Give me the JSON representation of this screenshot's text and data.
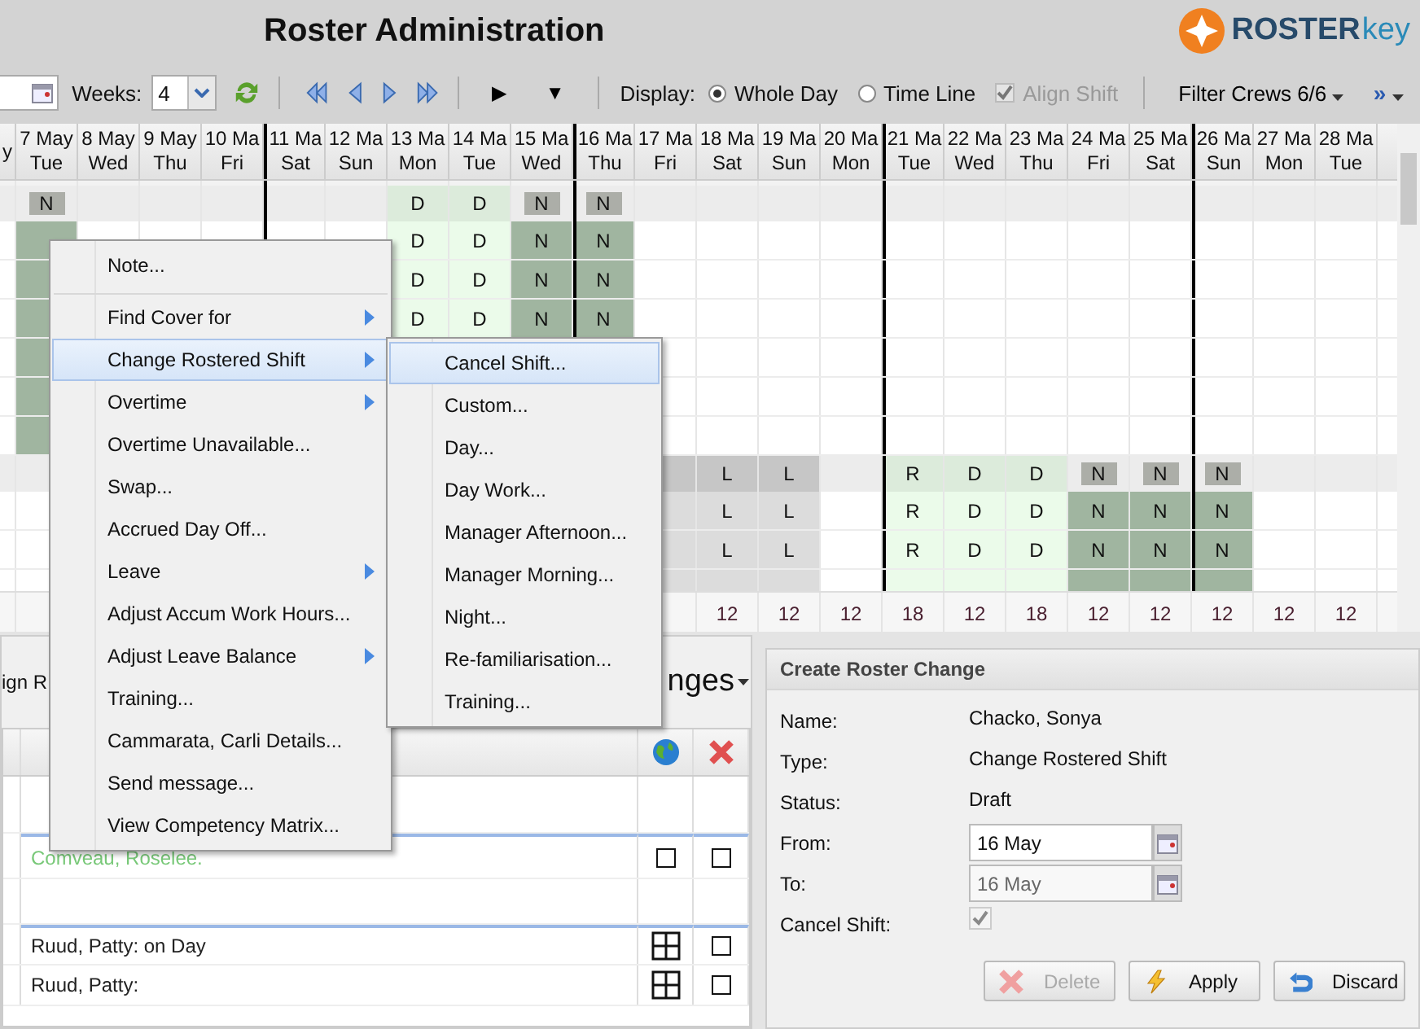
{
  "header": {
    "title": "Roster Administration",
    "logo_primary": "ROSTER",
    "logo_secondary": "key"
  },
  "toolbar": {
    "weeks_label": "Weeks:",
    "weeks_value": "4",
    "play_glyph": "▶",
    "down_glyph": "▼",
    "display_label": "Display:",
    "display_options": [
      {
        "label": "Whole Day",
        "selected": true
      },
      {
        "label": "Time Line",
        "selected": false
      }
    ],
    "align_shift": {
      "label": "Align Shift",
      "checked": true,
      "disabled": true
    },
    "filter_label": "Filter Crews 6/6",
    "more_glyph": "»"
  },
  "columns": [
    {
      "date": "y",
      "week_start": false
    },
    {
      "date": "7 May",
      "day": "Tue",
      "week_start": false
    },
    {
      "date": "8 May",
      "day": "Wed",
      "week_start": false
    },
    {
      "date": "9 May",
      "day": "Thu",
      "week_start": false
    },
    {
      "date": "10 Ma",
      "day": "Fri",
      "week_start": false
    },
    {
      "date": "11 Ma",
      "day": "Sat",
      "week_start": true
    },
    {
      "date": "12 Ma",
      "day": "Sun",
      "week_start": false
    },
    {
      "date": "13 Ma",
      "day": "Mon",
      "week_start": false
    },
    {
      "date": "14 Ma",
      "day": "Tue",
      "week_start": false
    },
    {
      "date": "15 Ma",
      "day": "Wed",
      "week_start": false
    },
    {
      "date": "16 Ma",
      "day": "Thu",
      "week_start": true
    },
    {
      "date": "17 Ma",
      "day": "Fri",
      "week_start": false
    },
    {
      "date": "18 Ma",
      "day": "Sat",
      "week_start": false,
      "total": "12"
    },
    {
      "date": "19 Ma",
      "day": "Sun",
      "week_start": false,
      "total": "12"
    },
    {
      "date": "20 Ma",
      "day": "Mon",
      "week_start": false,
      "total": "12"
    },
    {
      "date": "21 Ma",
      "day": "Tue",
      "week_start": true,
      "total": "18"
    },
    {
      "date": "22 Ma",
      "day": "Wed",
      "week_start": false,
      "total": "12"
    },
    {
      "date": "23 Ma",
      "day": "Thu",
      "week_start": false,
      "total": "18"
    },
    {
      "date": "24 Ma",
      "day": "Fri",
      "week_start": false,
      "total": "12"
    },
    {
      "date": "25 Ma",
      "day": "Sat",
      "week_start": false,
      "total": "12"
    },
    {
      "date": "26 Ma",
      "day": "Sun",
      "week_start": true,
      "total": "12"
    },
    {
      "date": "27 Ma",
      "day": "Mon",
      "week_start": false,
      "total": "12"
    },
    {
      "date": "28 Ma",
      "day": "Tue",
      "week_start": false,
      "total": "12"
    }
  ],
  "rows": [
    {
      "kind": "group",
      "cells": [
        null,
        {
          "code": "N",
          "kind": "night"
        },
        null,
        null,
        null,
        null,
        null,
        {
          "code": "D",
          "kind": "day"
        },
        {
          "code": "D",
          "kind": "day"
        },
        {
          "code": "N",
          "kind": "night"
        },
        {
          "code": "N",
          "kind": "night"
        },
        null,
        null,
        null,
        null,
        null,
        null,
        null,
        null,
        null,
        null,
        null,
        null
      ]
    },
    {
      "kind": "person",
      "cells": [
        null,
        {
          "kind": "night"
        },
        null,
        null,
        null,
        null,
        null,
        {
          "code": "D",
          "kind": "day"
        },
        {
          "code": "D",
          "kind": "day"
        },
        {
          "code": "N",
          "kind": "night"
        },
        {
          "code": "N",
          "kind": "night"
        },
        null,
        null,
        null,
        null,
        null,
        null,
        null,
        null,
        null,
        null,
        null,
        null
      ]
    },
    {
      "kind": "person",
      "cells": [
        null,
        {
          "kind": "night"
        },
        null,
        null,
        null,
        null,
        null,
        {
          "code": "D",
          "kind": "day"
        },
        {
          "code": "D",
          "kind": "day"
        },
        {
          "code": "N",
          "kind": "night"
        },
        {
          "code": "N",
          "kind": "night"
        },
        null,
        null,
        null,
        null,
        null,
        null,
        null,
        null,
        null,
        null,
        null,
        null
      ]
    },
    {
      "kind": "person",
      "cells": [
        null,
        {
          "kind": "night"
        },
        null,
        null,
        null,
        null,
        null,
        {
          "code": "D",
          "kind": "day"
        },
        {
          "code": "D",
          "kind": "day"
        },
        {
          "code": "N",
          "kind": "night"
        },
        {
          "code": "N",
          "kind": "night"
        },
        null,
        null,
        null,
        null,
        null,
        null,
        null,
        null,
        null,
        null,
        null,
        null
      ]
    },
    {
      "kind": "person",
      "cells": [
        null,
        {
          "kind": "night"
        },
        null,
        null,
        null,
        null,
        null,
        null,
        null,
        null,
        null,
        null,
        null,
        null,
        null,
        null,
        null,
        null,
        null,
        null,
        null,
        null,
        null
      ]
    },
    {
      "kind": "person",
      "cells": [
        null,
        {
          "kind": "night"
        },
        null,
        null,
        null,
        null,
        null,
        null,
        null,
        null,
        null,
        null,
        null,
        null,
        null,
        null,
        null,
        null,
        null,
        null,
        null,
        null,
        null
      ]
    },
    {
      "kind": "person",
      "cells": [
        null,
        {
          "kind": "night"
        },
        null,
        null,
        null,
        null,
        null,
        null,
        null,
        null,
        null,
        null,
        null,
        null,
        null,
        null,
        null,
        null,
        null,
        null,
        null,
        null,
        null
      ]
    },
    {
      "kind": "group",
      "cells": [
        null,
        null,
        null,
        null,
        null,
        null,
        null,
        null,
        null,
        null,
        null,
        {
          "kind": "leave"
        },
        {
          "code": "L",
          "kind": "leave"
        },
        {
          "code": "L",
          "kind": "leave"
        },
        null,
        {
          "code": "R",
          "kind": "day"
        },
        {
          "code": "D",
          "kind": "day"
        },
        {
          "code": "D",
          "kind": "day"
        },
        {
          "code": "N",
          "kind": "night"
        },
        {
          "code": "N",
          "kind": "night"
        },
        {
          "code": "N",
          "kind": "night"
        },
        null,
        null
      ]
    },
    {
      "kind": "person",
      "cells": [
        null,
        null,
        null,
        null,
        null,
        null,
        null,
        null,
        null,
        null,
        null,
        {
          "kind": "leave"
        },
        {
          "code": "L",
          "kind": "leave"
        },
        {
          "code": "L",
          "kind": "leave"
        },
        null,
        {
          "code": "R",
          "kind": "day"
        },
        {
          "code": "D",
          "kind": "day"
        },
        {
          "code": "D",
          "kind": "day"
        },
        {
          "code": "N",
          "kind": "night"
        },
        {
          "code": "N",
          "kind": "night"
        },
        {
          "code": "N",
          "kind": "night"
        },
        null,
        null
      ]
    },
    {
      "kind": "person",
      "cells": [
        null,
        null,
        null,
        null,
        null,
        null,
        null,
        null,
        null,
        null,
        null,
        {
          "kind": "leave"
        },
        {
          "code": "L",
          "kind": "leave"
        },
        {
          "code": "L",
          "kind": "leave"
        },
        null,
        {
          "code": "R",
          "kind": "day"
        },
        {
          "code": "D",
          "kind": "day"
        },
        {
          "code": "D",
          "kind": "day"
        },
        {
          "code": "N",
          "kind": "night"
        },
        {
          "code": "N",
          "kind": "night"
        },
        {
          "code": "N",
          "kind": "night"
        },
        null,
        null
      ]
    },
    {
      "kind": "person",
      "cells": [
        null,
        null,
        null,
        null,
        null,
        null,
        null,
        null,
        null,
        null,
        null,
        {
          "kind": "leave"
        },
        {
          "kind": "leave"
        },
        {
          "kind": "leave"
        },
        null,
        {
          "kind": "day"
        },
        {
          "kind": "day"
        },
        {
          "kind": "day"
        },
        {
          "kind": "night"
        },
        {
          "kind": "night"
        },
        {
          "kind": "night"
        },
        null,
        null
      ]
    }
  ],
  "context_menu": [
    {
      "label": "Note...",
      "submenu": false,
      "selected": false,
      "separator_after": true
    },
    {
      "label": "Find Cover for",
      "submenu": true,
      "selected": false,
      "separator_after": false
    },
    {
      "label": "Change Rostered Shift",
      "submenu": true,
      "selected": true,
      "separator_after": false
    },
    {
      "label": "Overtime",
      "submenu": true,
      "selected": false,
      "separator_after": false
    },
    {
      "label": "Overtime Unavailable...",
      "submenu": false,
      "selected": false,
      "separator_after": false
    },
    {
      "label": "Swap...",
      "submenu": false,
      "selected": false,
      "separator_after": false
    },
    {
      "label": "Accrued Day Off...",
      "submenu": false,
      "selected": false,
      "separator_after": false
    },
    {
      "label": "Leave",
      "submenu": true,
      "selected": false,
      "separator_after": false
    },
    {
      "label": "Adjust Accum Work Hours...",
      "submenu": false,
      "selected": false,
      "separator_after": false
    },
    {
      "label": "Adjust Leave Balance",
      "submenu": true,
      "selected": false,
      "separator_after": false
    },
    {
      "label": "Training...",
      "submenu": false,
      "selected": false,
      "separator_after": false
    },
    {
      "label": "Cammarata, Carli Details...",
      "submenu": false,
      "selected": false,
      "separator_after": false
    },
    {
      "label": "Send message...",
      "submenu": false,
      "selected": false,
      "separator_after": false
    },
    {
      "label": "View Competency Matrix...",
      "submenu": false,
      "selected": false,
      "separator_after": false
    }
  ],
  "submenu": [
    {
      "label": "Cancel Shift...",
      "selected": true
    },
    {
      "label": "Custom...",
      "selected": false
    },
    {
      "label": "Day...",
      "selected": false
    },
    {
      "label": "Day Work...",
      "selected": false
    },
    {
      "label": "Manager Afternoon...",
      "selected": false
    },
    {
      "label": "Manager Morning...",
      "selected": false
    },
    {
      "label": "Night...",
      "selected": false
    },
    {
      "label": "Re-familiarisation...",
      "selected": false
    },
    {
      "label": "Training...",
      "selected": false
    }
  ],
  "changes_panel": {
    "tab_fragment": "ign R",
    "title_fragment": "nges",
    "rows": [
      {
        "kind": "blank"
      },
      {
        "kind": "box",
        "group_start": true,
        "text": "Comveau, Roselee.",
        "color": "#78c878",
        "checked": false
      },
      {
        "kind": "blank"
      },
      {
        "kind": "grid",
        "group_start": true,
        "text": "Ruud, Patty: on Day",
        "color": "#222222",
        "checked": false
      },
      {
        "kind": "grid",
        "group_start": false,
        "text": "Ruud, Patty:",
        "color": "#222222",
        "checked": false
      }
    ]
  },
  "create_panel": {
    "title": "Create Roster Change",
    "fields": [
      {
        "label": "Name:",
        "kind": "text",
        "value": "Chacko, Sonya"
      },
      {
        "label": "Type:",
        "kind": "text",
        "value": "Change Rostered Shift"
      },
      {
        "label": "Status:",
        "kind": "text",
        "value": "Draft"
      },
      {
        "label": "From:",
        "kind": "date",
        "value": "16 May",
        "disabled": false
      },
      {
        "label": "To:",
        "kind": "date",
        "value": "16 May",
        "disabled": true
      },
      {
        "label": "Cancel Shift:",
        "kind": "check",
        "checked": true,
        "disabled": true
      }
    ],
    "buttons": [
      {
        "label": "Delete",
        "kind": "delete",
        "disabled": true
      },
      {
        "label": "Apply",
        "kind": "apply",
        "disabled": false
      },
      {
        "label": "Discard",
        "kind": "discard",
        "disabled": false
      }
    ]
  }
}
